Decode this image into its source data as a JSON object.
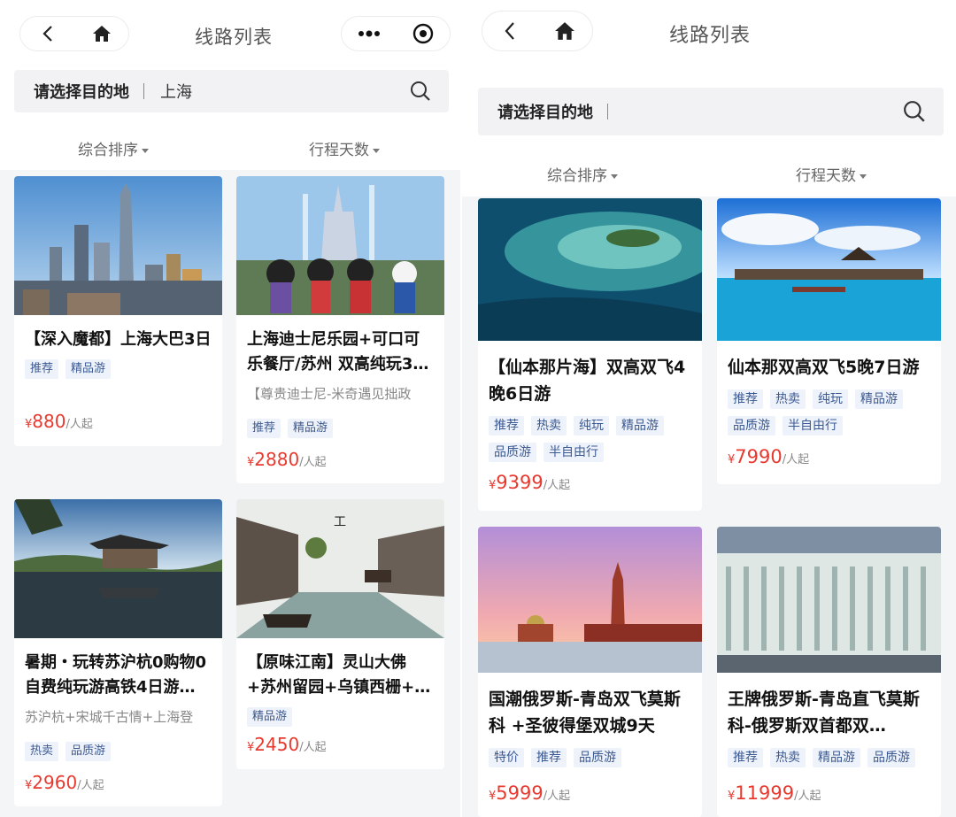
{
  "left": {
    "nav": {
      "title": "线路列表"
    },
    "search": {
      "label": "请选择目的地",
      "value": "上海"
    },
    "sort": {
      "composite": "综合排序",
      "days": "行程天数"
    },
    "cards": [
      {
        "title": "【深入魔都】上海大巴3日",
        "subtitle": "",
        "tags": [
          "推荐",
          "精品游"
        ],
        "price_symbol": "¥",
        "price": "880",
        "unit": "/人起"
      },
      {
        "title": "上海迪士尼乐园+可口可乐餐厅/苏州 双高纯玩3…",
        "subtitle": "【尊贵迪士尼-米奇遇见拙政",
        "tags": [
          "推荐",
          "精品游"
        ],
        "price_symbol": "¥",
        "price": "2880",
        "unit": "/人起"
      },
      {
        "title": "暑期・玩转苏沪杭0购物0自费纯玩游高铁4日游…",
        "subtitle": "苏沪杭+宋城千古情+上海登",
        "tags": [
          "热卖",
          "品质游"
        ],
        "price_symbol": "¥",
        "price": "2960",
        "unit": "/人起"
      },
      {
        "title": "【原味江南】灵山大佛+苏州留园+乌镇西栅+…",
        "subtitle": "",
        "tags": [
          "精品游"
        ],
        "price_symbol": "¥",
        "price": "2450",
        "unit": "/人起"
      }
    ]
  },
  "right": {
    "nav": {
      "title": "线路列表"
    },
    "search": {
      "label": "请选择目的地",
      "value": ""
    },
    "sort": {
      "composite": "综合排序",
      "days": "行程天数"
    },
    "cards": [
      {
        "title": "【仙本那片海】双高双飞4晚6日游",
        "subtitle": "",
        "tags": [
          "推荐",
          "热卖",
          "纯玩",
          "精品游",
          "品质游",
          "半自由行"
        ],
        "price_symbol": "¥",
        "price": "9399",
        "unit": "/人起"
      },
      {
        "title": "仙本那双高双飞5晚7日游",
        "subtitle": "",
        "tags": [
          "推荐",
          "热卖",
          "纯玩",
          "精品游",
          "品质游",
          "半自由行"
        ],
        "price_symbol": "¥",
        "price": "7990",
        "unit": "/人起"
      },
      {
        "title": "国潮俄罗斯-青岛双飞莫斯科 +圣彼得堡双城9天",
        "subtitle": "",
        "tags": [
          "特价",
          "推荐",
          "品质游"
        ],
        "price_symbol": "¥",
        "price": "5999",
        "unit": "/人起"
      },
      {
        "title": "王牌俄罗斯-青岛直飞莫斯科-俄罗斯双首都双…",
        "subtitle": "",
        "tags": [
          "推荐",
          "热卖",
          "精品游",
          "品质游"
        ],
        "price_symbol": "¥",
        "price": "11999",
        "unit": "/人起"
      }
    ]
  }
}
